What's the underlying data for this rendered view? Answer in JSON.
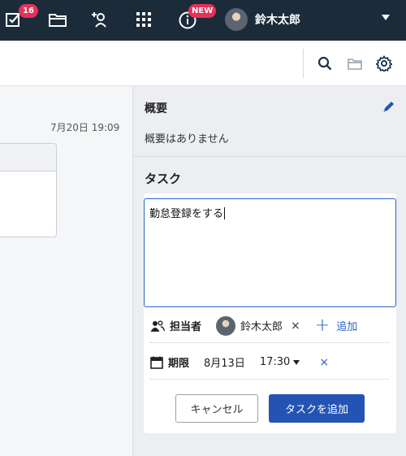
{
  "nav": {
    "tasks_badge": "16",
    "info_badge": "NEW",
    "user_name": "鈴木太郎"
  },
  "content": {
    "timestamp": "7月20日 19:09"
  },
  "panel": {
    "summary_title": "概要",
    "summary_text": "概要はありません",
    "task_title": "タスク",
    "task_input_value": "勤怠登録をする",
    "assignee_label": "担当者",
    "assignee_name": "鈴木太郎",
    "remove_mark": "×",
    "add_label": "追加",
    "due_label": "期限",
    "due_date": "8月13日",
    "due_time": "17:30",
    "cancel_label": "キャンセル",
    "submit_label": "タスクを追加"
  },
  "colors": {
    "nav_bg": "#1c2b3a",
    "accent": "#2354b5",
    "badge": "#e4325a"
  },
  "icons": [
    "task-check-icon",
    "folder-icon",
    "user-add-icon",
    "apps-grid-icon",
    "info-icon",
    "chevron-down-icon",
    "search-icon",
    "folder-icon",
    "gear-icon",
    "pencil-icon",
    "people-icon",
    "calendar-icon",
    "caret-down-icon",
    "close-icon",
    "plus-icon"
  ]
}
